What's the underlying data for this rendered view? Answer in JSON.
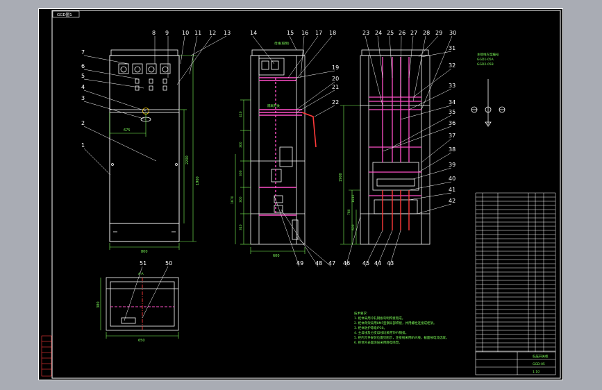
{
  "title_tag": "GGD图1",
  "callouts_top": [
    "8",
    "9",
    "10",
    "11",
    "12",
    "13",
    "14",
    "15",
    "16",
    "17",
    "18",
    "23",
    "24",
    "25",
    "26",
    "27",
    "28",
    "29",
    "30"
  ],
  "callouts_left": [
    "7",
    "6",
    "5",
    "4",
    "3",
    "2",
    "1"
  ],
  "callouts_mid": [
    "19",
    "20",
    "21",
    "22"
  ],
  "callouts_right": [
    "31",
    "32",
    "33",
    "34",
    "35",
    "36",
    "37",
    "38",
    "39",
    "40",
    "41",
    "42"
  ],
  "callouts_bottom": [
    "49",
    "48",
    "47",
    "46",
    "45",
    "44",
    "43"
  ],
  "callouts_plan": [
    "51",
    "50"
  ],
  "dims": {
    "front_width": "800",
    "front_inner_height": "2200",
    "front_total_height": "1900",
    "front_offset": "675",
    "side_width": "600",
    "side_heights": [
      "410",
      "300",
      "300",
      "300",
      "310",
      "1870"
    ],
    "back_heights": [
      "1900",
      "780",
      "1810",
      "600"
    ],
    "plan_width": "650",
    "plan_depth": "380",
    "plan_caption": "A-A"
  },
  "schematic": {
    "heading": "主接线方案编号",
    "lines": [
      "GGD1-05A",
      "GGD2-05B"
    ]
  },
  "labels_side": {
    "top_green": "母线(照明)",
    "mid_green": "隔离开关"
  },
  "notes": {
    "heading": "技术要求:",
    "lines": [
      "1. 柜体采用冷轧钢板弯制焊接而成。",
      "2. 柜体骨架采用8MF型钢局部焊接，并用螺栓连接成柜架。",
      "3. 柜体防护等级IP30。",
      "4. 主母线及分支母线均采用TMY铜排。",
      "5. 柜内元件安装位置见图示，连接线采用BVR线，截面按电流选取。",
      "6. 柜体外表面涂层采用静电喷塑。"
    ]
  },
  "title_block": {
    "drawing_name": "低压开关柜",
    "drawing_no": "GGD-05",
    "scale": "1:10"
  },
  "colors": {
    "background": "#000000",
    "frame": "#ffffff",
    "dimension": "#7fff5a",
    "busbar": "#ff4fc8",
    "conductor": "#ff3a3a",
    "callout": "#ffffff"
  }
}
